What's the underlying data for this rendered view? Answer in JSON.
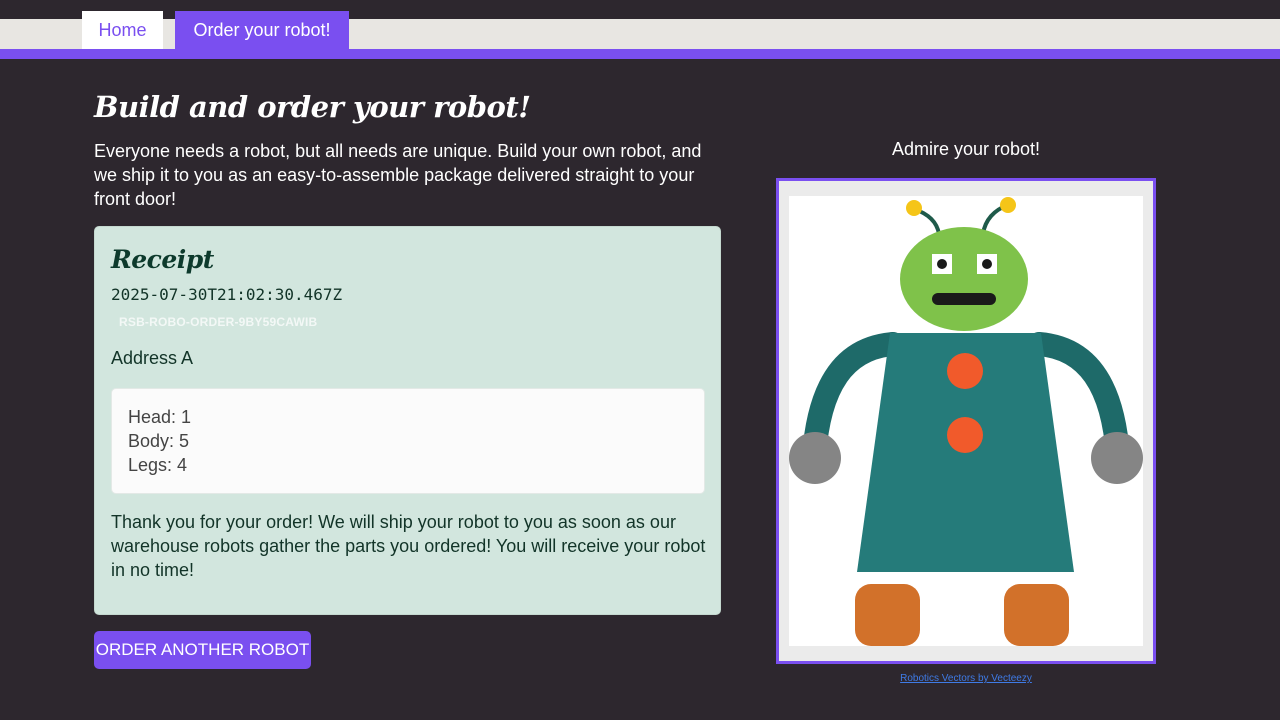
{
  "nav": {
    "home_label": "Home",
    "order_label": "Order your robot!"
  },
  "main": {
    "title": "Build and order your robot!",
    "intro": "Everyone needs a robot, but all needs are unique. Build your own robot, and we ship it to you as an easy-to-assemble package delivered straight to your front door!"
  },
  "receipt": {
    "title": "Receipt",
    "timestamp": "2025-07-30T21:02:30.467Z",
    "order_id": "RSB-ROBO-ORDER-9BY59CAWIB",
    "address": "Address A",
    "parts": [
      "Head: 1",
      "Body: 5",
      "Legs: 4"
    ],
    "thanks": "Thank you for your order! We will ship your robot to you as soon as our warehouse robots gather the parts you ordered! You will receive your robot in no time!"
  },
  "order_another_label": "ORDER ANOTHER ROBOT",
  "preview": {
    "title": "Admire your robot!",
    "credit": "Robotics Vectors by Vecteezy"
  },
  "colors": {
    "background": "#2d272e",
    "accent": "#7a4ff0",
    "receipt_bg": "#d2e6de",
    "robot_head": "#7fc24a",
    "robot_body": "#257b7a",
    "robot_button": "#f15a2b",
    "robot_legs": "#d2712a"
  }
}
